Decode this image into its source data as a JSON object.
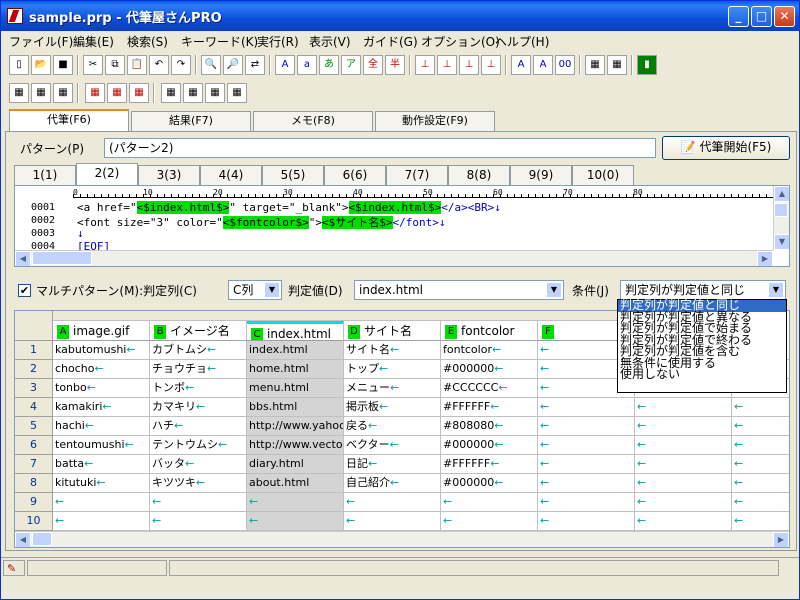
{
  "window": {
    "title": "sample.prp - 代筆屋さんPRO"
  },
  "menu": [
    "ファイル(F)",
    "編集(E)",
    "検索(S)",
    "キーワード(K)",
    "実行(R)",
    "表示(V)",
    "ガイド(G)",
    "オプション(O)",
    "ヘルプ(H)"
  ],
  "main_tabs": [
    {
      "label": "代筆(F6)"
    },
    {
      "label": "結果(F7)"
    },
    {
      "label": "メモ(F8)"
    },
    {
      "label": "動作設定(F9)"
    }
  ],
  "pattern": {
    "label": "パターン(P)",
    "value": "(パターン2)",
    "start_button": "代筆開始(F5)"
  },
  "sub_tabs": [
    "1(1)",
    "2(2)",
    "3(3)",
    "4(4)",
    "5(5)",
    "6(6)",
    "7(7)",
    "8(8)",
    "9(9)",
    "10(0)"
  ],
  "ruler": [
    "0",
    "10",
    "20",
    "30",
    "40",
    "50",
    "60",
    "70",
    "80"
  ],
  "editor": {
    "lines": [
      {
        "num": "0001",
        "segments": [
          {
            "t": "<a href=\"",
            "h": false
          },
          {
            "t": "<$index.html$>",
            "h": true
          },
          {
            "t": "\" target=\"_blank\">",
            "h": false
          },
          {
            "t": "<$index.html$>",
            "h": true
          },
          {
            "t": "</a><BR>↓",
            "h": false
          }
        ]
      },
      {
        "num": "0002",
        "segments": [
          {
            "t": "<font size=\"3\" color=\"",
            "h": false
          },
          {
            "t": "<$fontcolor$>",
            "h": true
          },
          {
            "t": "\">",
            "h": false
          },
          {
            "t": "<$サイト名$>",
            "h": true
          },
          {
            "t": "</font>↓",
            "h": false
          }
        ]
      },
      {
        "num": "0003",
        "segments": [
          {
            "t": "↓",
            "h": false
          }
        ]
      },
      {
        "num": "0004",
        "segments": [
          {
            "t": "[EOF]",
            "h": false
          }
        ]
      }
    ]
  },
  "multi": {
    "checkbox_label": "マルチパターン(M):判定列(C)",
    "column_value": "C列",
    "value_label": "判定値(D)",
    "value": "index.html",
    "condition_label": "条件(J)",
    "condition_value": "判定列が判定値と同じ",
    "options": [
      "判定列が判定値と同じ",
      "判定列が判定値と異なる",
      "判定列が判定値で始まる",
      "判定列が判定値で終わる",
      "判定列が判定値を含む",
      "無条件に使用する",
      "使用しない"
    ]
  },
  "sheet": {
    "columns": [
      {
        "letter": "A",
        "name": "image.gif"
      },
      {
        "letter": "B",
        "name": "イメージ名"
      },
      {
        "letter": "C",
        "name": "index.html"
      },
      {
        "letter": "D",
        "name": "サイト名"
      },
      {
        "letter": "E",
        "name": "fontcolor"
      },
      {
        "letter": "F",
        "name": ""
      }
    ],
    "rows": [
      {
        "n": "1",
        "cells": [
          "kabutomushi",
          "カブトムシ",
          "index.html",
          "サイト名",
          "fontcolor",
          ""
        ]
      },
      {
        "n": "2",
        "cells": [
          "chocho",
          "チョウチョ",
          "home.html",
          "トップ",
          "#000000",
          ""
        ]
      },
      {
        "n": "3",
        "cells": [
          "tonbo",
          "トンボ",
          "menu.html",
          "メニュー",
          "#CCCCCC",
          ""
        ]
      },
      {
        "n": "4",
        "cells": [
          "kamakiri",
          "カマキリ",
          "bbs.html",
          "掲示板",
          "#FFFFFF",
          ""
        ]
      },
      {
        "n": "5",
        "cells": [
          "hachi",
          "ハチ",
          "http://www.yahoo",
          "戻る",
          "#808080",
          ""
        ]
      },
      {
        "n": "6",
        "cells": [
          "tentoumushi",
          "テントウムシ",
          "http://www.vecto",
          "ベクター",
          "#000000",
          ""
        ]
      },
      {
        "n": "7",
        "cells": [
          "batta",
          "バッタ",
          "diary.html",
          "日記",
          "#FFFFFF",
          ""
        ]
      },
      {
        "n": "8",
        "cells": [
          "kitutuki",
          "キツツキ",
          "about.html",
          "自己紹介",
          "#000000",
          ""
        ]
      },
      {
        "n": "9",
        "cells": [
          "",
          "",
          "",
          "",
          "",
          ""
        ]
      },
      {
        "n": "10",
        "cells": [
          "",
          "",
          "",
          "",
          "",
          ""
        ]
      }
    ],
    "arrow": "←"
  },
  "colors": {
    "highlight": "#00e000",
    "selection": "#316ac5",
    "title_blue": "#0b4fd9"
  }
}
